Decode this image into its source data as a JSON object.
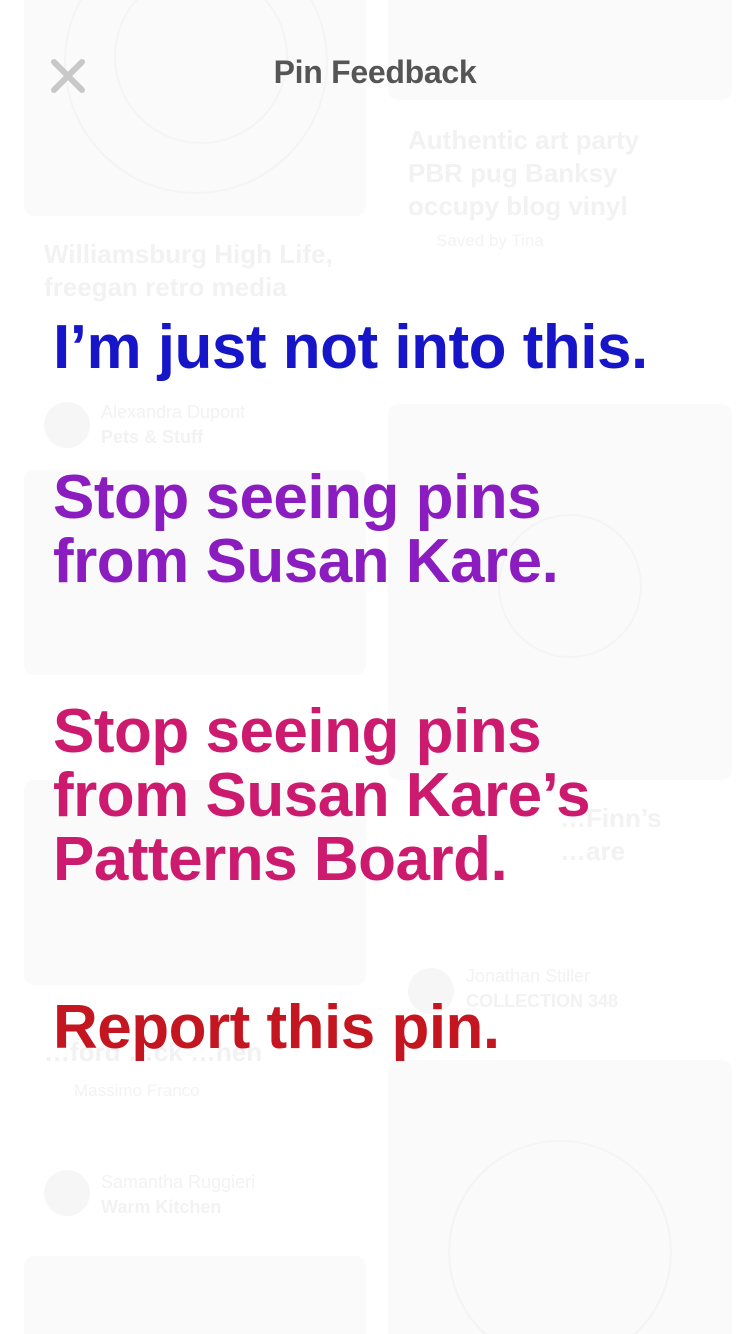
{
  "header": {
    "title": "Pin Feedback",
    "close_icon": "close-icon"
  },
  "options": [
    {
      "label": "I’m just not into this.",
      "color": "#1616c8"
    },
    {
      "label": "Stop seeing pins\nfrom Susan Kare.",
      "color": "#8a1cc0"
    },
    {
      "label": "Stop seeing pins\nfrom Susan Kare’s\nPatterns Board.",
      "color": "#cc1a6e"
    },
    {
      "label": "Report this pin.",
      "color": "#c41620"
    }
  ],
  "background_feed": [
    {
      "title": "Williamsburg High Life,\nfreegan retro media",
      "author": "Alexandra Dupont",
      "board": "Pets & Stuff"
    },
    {
      "title": "Authentic art party\nPBR pug Banksy\noccupy blog vinyl",
      "meta": "Saved by Tina"
    },
    {
      "title": "…Finn’s\n…are",
      "author": "Jonathan Stiller",
      "board": "COLLECTION 348"
    },
    {
      "title": "…ford …ck …hen",
      "meta": "Massimo Franco",
      "author": "Samantha Ruggieri",
      "board": "Warm Kitchen"
    }
  ]
}
